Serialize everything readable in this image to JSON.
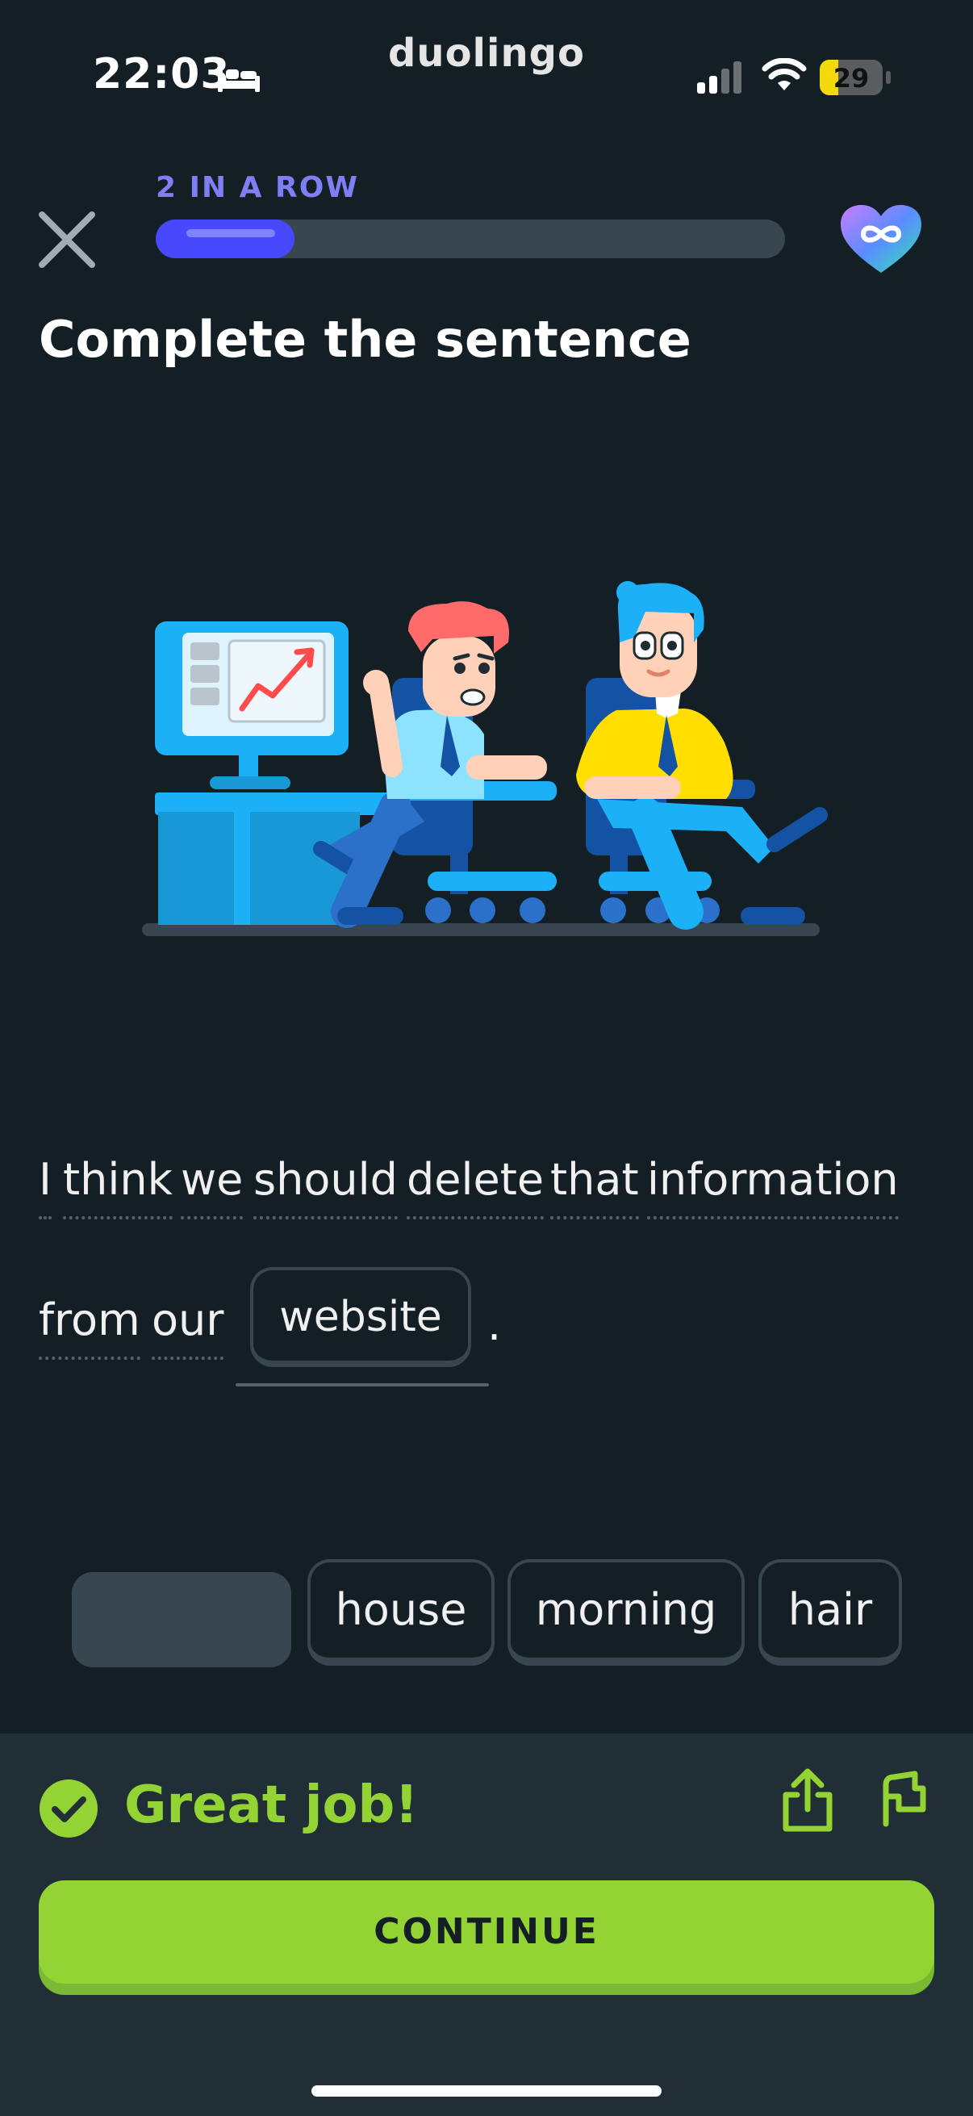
{
  "status_bar": {
    "time": "22:03",
    "brand": "duolingo",
    "battery": "29",
    "battery_level": 0.29
  },
  "lesson": {
    "streak_text": "2 IN A ROW",
    "progress": 0.22,
    "title": "Complete the sentence",
    "sentence": {
      "line1": [
        "I",
        "think",
        "we",
        "should",
        "delete",
        "that",
        "information"
      ],
      "line2": [
        "from",
        "our"
      ],
      "answer": "website",
      "end": "."
    },
    "word_bank": [
      "house",
      "morning",
      "hair"
    ]
  },
  "feedback": {
    "message": "Great job!",
    "continue_label": "CONTINUE"
  },
  "icons": {
    "close": "close-icon",
    "hearts": "infinite-hearts-icon",
    "share": "share-icon",
    "report": "report-flag-icon",
    "check": "check-circle-icon"
  },
  "colors": {
    "background": "#131f24",
    "accent_green": "#93d333",
    "progress_blue": "#4848ff",
    "streak_purple": "#7f7ff5"
  }
}
